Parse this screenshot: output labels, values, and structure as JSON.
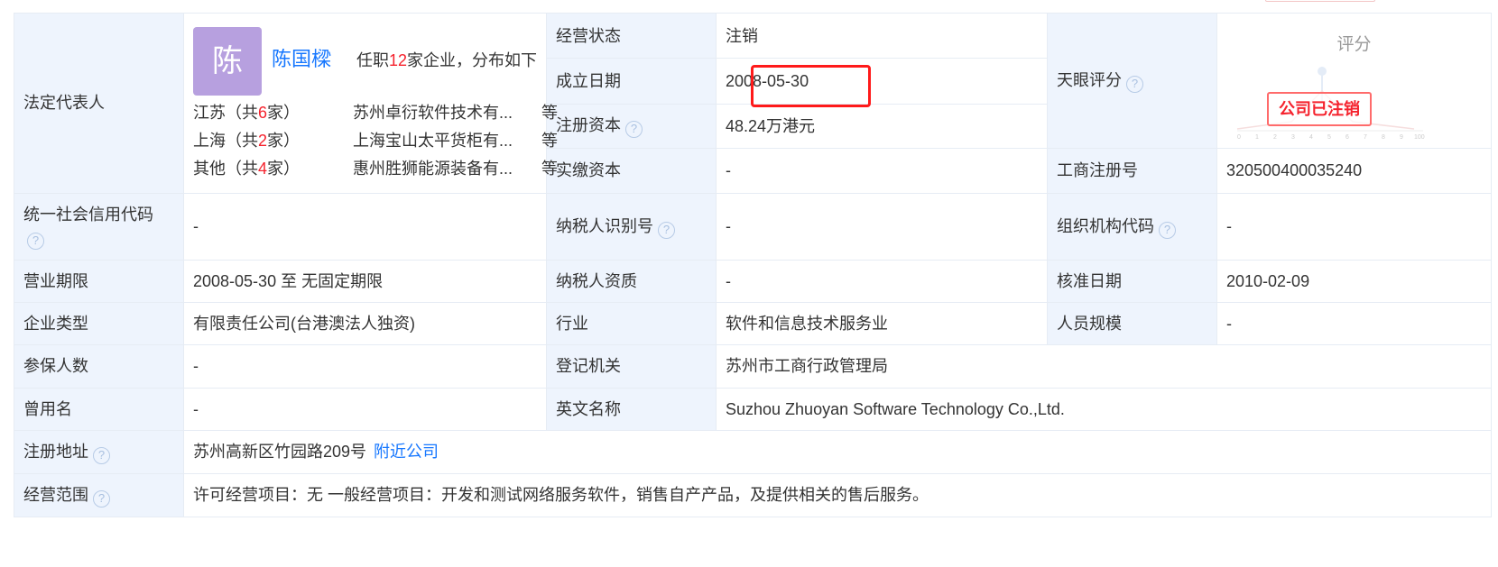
{
  "legal_rep": {
    "label": "法定代表人",
    "avatar_char": "陈",
    "name": "陈国樑",
    "summary_prefix": "任职",
    "summary_count": "12",
    "summary_suffix": "家企业，分布如下",
    "provinces": [
      {
        "pre": "江苏（共",
        "num": "6",
        "post": "家）",
        "company": "苏州卓衍软件技术有...",
        "more": "等"
      },
      {
        "pre": "上海（共",
        "num": "2",
        "post": "家）",
        "company": "上海宝山太平货柜有...",
        "more": "等"
      },
      {
        "pre": "其他（共",
        "num": "4",
        "post": "家）",
        "company": "惠州胜狮能源装备有...",
        "more": "等"
      }
    ]
  },
  "status": {
    "label": "经营状态",
    "value": "注销"
  },
  "founded": {
    "label": "成立日期",
    "value": "2008-05-30"
  },
  "reg_capital": {
    "label": "注册资本",
    "value": "48.24万港元"
  },
  "paid_capital": {
    "label": "实缴资本",
    "value": "-"
  },
  "tianyan": {
    "label": "天眼评分"
  },
  "rating": {
    "title": "评分",
    "stamp": "公司已注销",
    "scale": [
      "0",
      "1",
      "2",
      "3",
      "4",
      "5",
      "6",
      "7",
      "8",
      "9",
      "100"
    ],
    "colors": {
      "stamp": "#f5222d"
    }
  },
  "biz_reg_no": {
    "label": "工商注册号",
    "value": "320500400035240"
  },
  "credit_code": {
    "label": "统一社会信用代码",
    "value": "-"
  },
  "taxpayer_id": {
    "label": "纳税人识别号",
    "value": "-"
  },
  "org_code": {
    "label": "组织机构代码",
    "value": "-"
  },
  "biz_term": {
    "label": "营业期限",
    "value": "2008-05-30 至 无固定期限"
  },
  "taxpayer_qual": {
    "label": "纳税人资质",
    "value": "-"
  },
  "approval_date": {
    "label": "核准日期",
    "value": "2010-02-09"
  },
  "company_type": {
    "label": "企业类型",
    "value": "有限责任公司(台港澳法人独资)"
  },
  "industry": {
    "label": "行业",
    "value": "软件和信息技术服务业"
  },
  "staff_size": {
    "label": "人员规模",
    "value": "-"
  },
  "insured": {
    "label": "参保人数",
    "value": "-"
  },
  "reg_authority": {
    "label": "登记机关",
    "value": "苏州市工商行政管理局"
  },
  "former_name": {
    "label": "曾用名",
    "value": "-"
  },
  "english_name": {
    "label": "英文名称",
    "value": "Suzhou Zhuoyan Software Technology Co.,Ltd."
  },
  "reg_address": {
    "label": "注册地址",
    "value": "苏州高新区竹园路209号",
    "link": "附近公司"
  },
  "scope": {
    "label": "经营范围",
    "value": "许可经营项目：无 一般经营项目：开发和测试网络服务软件，销售自产产品，及提供相关的售后服务。"
  },
  "help_icon": "question-circle-icon",
  "colors": {
    "label_bg": "#eef4fd",
    "border": "#e6ecf4",
    "link": "#1677ff",
    "highlight": "#ff1a1a",
    "accent_red": "#f5222d"
  }
}
